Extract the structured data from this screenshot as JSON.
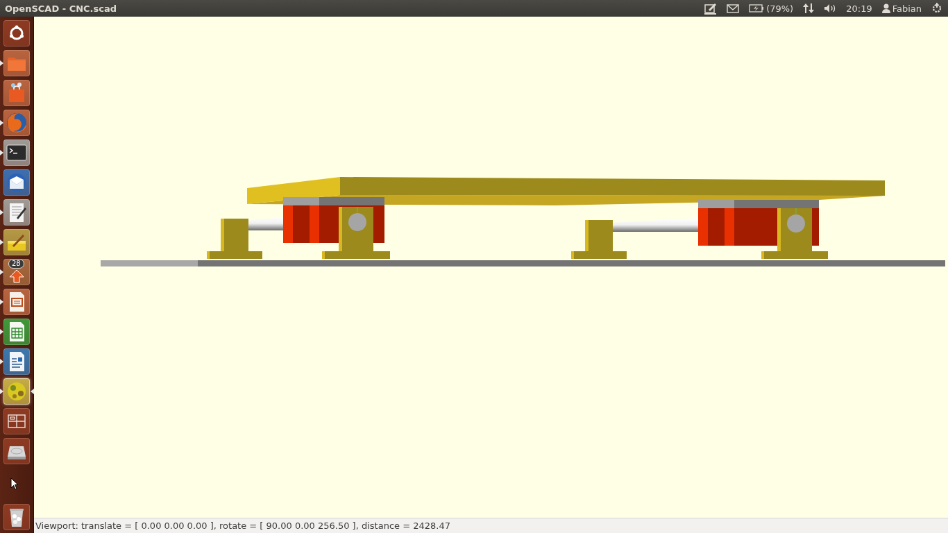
{
  "window": {
    "title": "OpenSCAD - CNC.scad"
  },
  "panel": {
    "battery": "(79%)",
    "clock": "20:19",
    "user": "Fabian"
  },
  "launcher": [
    {
      "kind": "dash",
      "running": false,
      "selected": false
    },
    {
      "kind": "files",
      "running": true,
      "selected": false
    },
    {
      "kind": "software",
      "running": false,
      "selected": false
    },
    {
      "kind": "browser",
      "running": true,
      "selected": false
    },
    {
      "kind": "terminal",
      "running": true,
      "selected": false
    },
    {
      "kind": "mail",
      "running": false,
      "selected": false
    },
    {
      "kind": "editor",
      "running": true,
      "selected": false
    },
    {
      "kind": "notes",
      "running": true,
      "selected": false
    },
    {
      "kind": "updates",
      "running": true,
      "selected": false,
      "badge": "28"
    },
    {
      "kind": "impress",
      "running": true,
      "selected": false
    },
    {
      "kind": "calc",
      "running": true,
      "selected": false
    },
    {
      "kind": "writer",
      "running": true,
      "selected": false
    },
    {
      "kind": "openscad",
      "running": true,
      "selected": true
    },
    {
      "kind": "workspaces",
      "running": false,
      "selected": false
    },
    {
      "kind": "drive",
      "running": false,
      "selected": false
    },
    {
      "kind": "trash",
      "running": false,
      "selected": false
    }
  ],
  "status_bar": {
    "text": "Viewport: translate = [ 0.00 0.00 0.00 ], rotate = [ 90.00 0.00 256.50 ], distance = 2428.47"
  }
}
